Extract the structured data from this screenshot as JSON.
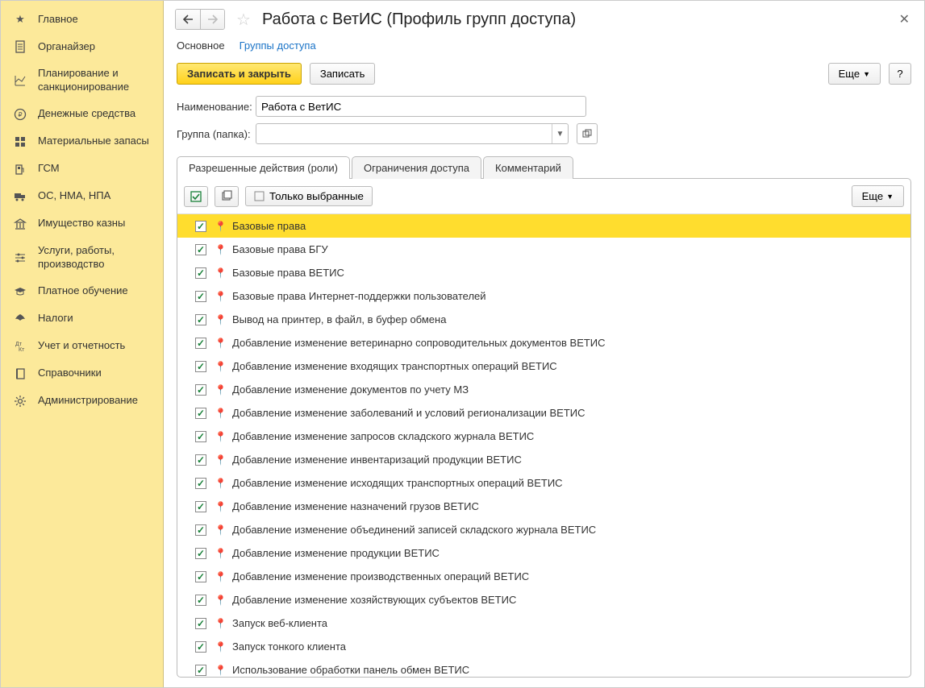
{
  "sidebar": {
    "items": [
      {
        "label": "Главное"
      },
      {
        "label": "Органайзер"
      },
      {
        "label": "Планирование и санкционирование"
      },
      {
        "label": "Денежные средства"
      },
      {
        "label": "Материальные запасы"
      },
      {
        "label": "ГСМ"
      },
      {
        "label": "ОС, НМА, НПА"
      },
      {
        "label": "Имущество казны"
      },
      {
        "label": "Услуги, работы, производство"
      },
      {
        "label": "Платное обучение"
      },
      {
        "label": "Налоги"
      },
      {
        "label": "Учет и отчетность"
      },
      {
        "label": "Справочники"
      },
      {
        "label": "Администрирование"
      }
    ]
  },
  "header": {
    "title": "Работа с ВетИС (Профиль групп доступа)"
  },
  "subtabs": {
    "main": "Основное",
    "groups": "Группы доступа"
  },
  "toolbar": {
    "save_close": "Записать и закрыть",
    "save": "Записать",
    "more": "Еще",
    "help": "?"
  },
  "fields": {
    "name_label": "Наименование:",
    "name_value": "Работа с ВетИС",
    "group_label": "Группа (папка):",
    "group_value": ""
  },
  "tabs": {
    "roles": "Разрешенные действия (роли)",
    "restrictions": "Ограничения доступа",
    "comment": "Комментарий"
  },
  "panel_toolbar": {
    "only_selected": "Только выбранные",
    "more": "Еще"
  },
  "roles": [
    {
      "checked": true,
      "label": "Базовые права",
      "selected": true
    },
    {
      "checked": true,
      "label": "Базовые права БГУ"
    },
    {
      "checked": true,
      "label": "Базовые права ВЕТИС"
    },
    {
      "checked": true,
      "label": "Базовые права Интернет-поддержки пользователей"
    },
    {
      "checked": true,
      "label": "Вывод на принтер, в файл, в буфер обмена"
    },
    {
      "checked": true,
      "label": "Добавление изменение ветеринарно сопроводительных документов ВЕТИС"
    },
    {
      "checked": true,
      "label": "Добавление изменение входящих транспортных операций ВЕТИС"
    },
    {
      "checked": true,
      "label": "Добавление изменение документов по учету МЗ"
    },
    {
      "checked": true,
      "label": "Добавление изменение заболеваний и условий регионализации ВЕТИС"
    },
    {
      "checked": true,
      "label": "Добавление изменение запросов складского журнала ВЕТИС"
    },
    {
      "checked": true,
      "label": "Добавление изменение инвентаризаций продукции ВЕТИС"
    },
    {
      "checked": true,
      "label": "Добавление изменение исходящих транспортных операций ВЕТИС"
    },
    {
      "checked": true,
      "label": "Добавление изменение назначений грузов ВЕТИС"
    },
    {
      "checked": true,
      "label": "Добавление изменение объединений записей складского журнала ВЕТИС"
    },
    {
      "checked": true,
      "label": "Добавление изменение продукции ВЕТИС"
    },
    {
      "checked": true,
      "label": "Добавление изменение производственных операций ВЕТИС"
    },
    {
      "checked": true,
      "label": "Добавление изменение хозяйствующих субъектов ВЕТИС"
    },
    {
      "checked": true,
      "label": "Запуск веб-клиента"
    },
    {
      "checked": true,
      "label": "Запуск тонкого клиента"
    },
    {
      "checked": true,
      "label": "Использование обработки панель обмен ВЕТИС"
    }
  ]
}
